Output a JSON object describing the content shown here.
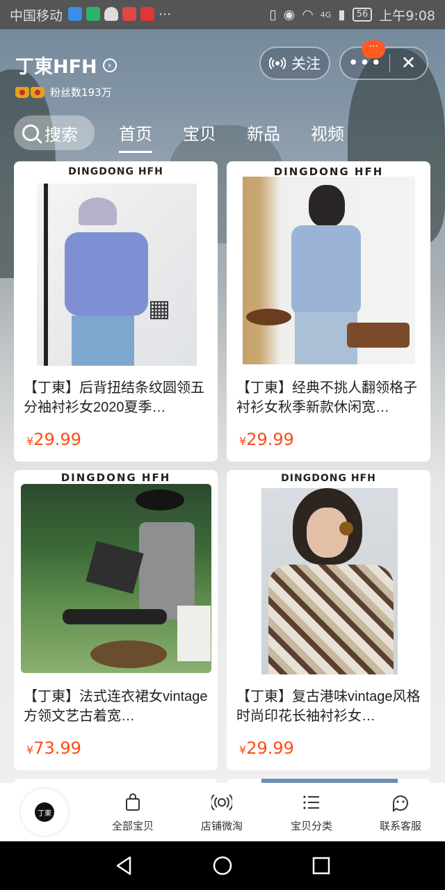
{
  "status_bar": {
    "carrier": "中国移动",
    "network": "4G",
    "battery": "56",
    "time": "上午9:08"
  },
  "shop": {
    "name": "丁東HFH",
    "fans": "粉丝数193万",
    "follow_label": "关注",
    "more_badge": "···"
  },
  "tabs": {
    "search_label": "搜索",
    "items": [
      "首页",
      "宝贝",
      "新品",
      "视频"
    ],
    "active": "首页"
  },
  "products": [
    {
      "brand": "DINGDONG  HFH",
      "title": "【丁東】后背扭结条纹圆领五分袖衬衫女2020夏季…",
      "currency": "¥",
      "price": "29.99"
    },
    {
      "brand": "DINGDONG HFH",
      "title": "【丁東】经典不挑人翻领格子衬衫女秋季新款休闲宽…",
      "currency": "¥",
      "price": "29.99"
    },
    {
      "brand": "DINGDONG HFH",
      "title": "【丁東】法式连衣裙女vintage方领文艺古着宽…",
      "currency": "¥",
      "price": "73.99"
    },
    {
      "brand": "DINGDONG HFH",
      "title": "【丁東】复古港味vintage风格时尚印花长袖衬衫女…",
      "currency": "¥",
      "price": "29.99"
    }
  ],
  "bottom_tabs": [
    {
      "label": "全部宝贝",
      "icon": "shopping-bag-icon"
    },
    {
      "label": "店铺微淘",
      "icon": "broadcast-icon"
    },
    {
      "label": "宝贝分类",
      "icon": "list-icon"
    },
    {
      "label": "联系客服",
      "icon": "chat-face-icon"
    }
  ],
  "logo_text": "丁東",
  "colors": {
    "price": "#ff4a16",
    "badge": "#ff5a1f"
  }
}
